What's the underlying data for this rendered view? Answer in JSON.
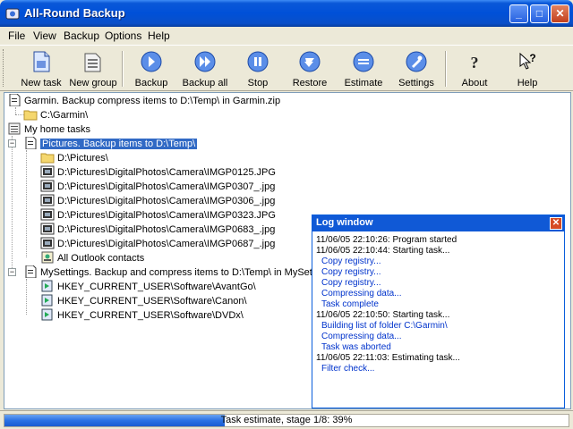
{
  "window": {
    "title": "All-Round Backup",
    "controls": {
      "minimize": "_",
      "maximize": "□",
      "close": "✕"
    }
  },
  "menu": [
    {
      "label": "File"
    },
    {
      "label": "View"
    },
    {
      "label": "Backup"
    },
    {
      "label": "Options"
    },
    {
      "label": "Help"
    }
  ],
  "toolbar": {
    "buttons": [
      {
        "label": "New task",
        "icon": "new-task-icon"
      },
      {
        "label": "New group",
        "icon": "new-group-icon"
      },
      {
        "label": "Backup",
        "icon": "backup-icon"
      },
      {
        "label": "Backup all",
        "icon": "backup-all-icon"
      },
      {
        "label": "Stop",
        "icon": "stop-icon"
      },
      {
        "label": "Restore",
        "icon": "restore-icon"
      },
      {
        "label": "Estimate",
        "icon": "estimate-icon"
      },
      {
        "label": "Settings",
        "icon": "settings-icon"
      },
      {
        "label": "About",
        "icon": "about-icon"
      },
      {
        "label": "Help",
        "icon": "help-icon"
      }
    ]
  },
  "tree": {
    "garmin_task": "Garmin. Backup compress items to D:\\Temp\\ in Garmin.zip",
    "garmin_folder": "C:\\Garmin\\",
    "group": "My home tasks",
    "pictures_task": "Pictures. Backup items to D:\\Temp\\",
    "pictures_items": [
      "D:\\Pictures\\",
      "D:\\Pictures\\DigitalPhotos\\Camera\\IMGP0125.JPG",
      "D:\\Pictures\\DigitalPhotos\\Camera\\IMGP0307_.jpg",
      "D:\\Pictures\\DigitalPhotos\\Camera\\IMGP0306_.jpg",
      "D:\\Pictures\\DigitalPhotos\\Camera\\IMGP0323.JPG",
      "D:\\Pictures\\DigitalPhotos\\Camera\\IMGP0683_.jpg",
      "D:\\Pictures\\DigitalPhotos\\Camera\\IMGP0687_.jpg",
      "All Outlook contacts"
    ],
    "settings_task": "MySettings. Backup and compress items to D:\\Temp\\ in MySettings",
    "settings_items": [
      "HKEY_CURRENT_USER\\Software\\AvantGo\\",
      "HKEY_CURRENT_USER\\Software\\Canon\\",
      "HKEY_CURRENT_USER\\Software\\DVDx\\"
    ]
  },
  "log": {
    "title": "Log window",
    "lines": [
      {
        "text": "11/06/05 22:10:26: Program started",
        "sub": false
      },
      {
        "text": "11/06/05 22:10:44: Starting task...",
        "sub": false
      },
      {
        "text": "Copy registry...",
        "sub": true
      },
      {
        "text": "Copy registry...",
        "sub": true
      },
      {
        "text": "Copy registry...",
        "sub": true
      },
      {
        "text": "Compressing data...",
        "sub": true
      },
      {
        "text": "Task complete",
        "sub": true
      },
      {
        "text": "11/06/05 22:10:50: Starting task...",
        "sub": false
      },
      {
        "text": "Building list of folder C:\\Garmin\\",
        "sub": true
      },
      {
        "text": "Compressing data...",
        "sub": true
      },
      {
        "text": "Task was aborted",
        "sub": true
      },
      {
        "text": "11/06/05 22:11:03: Estimating task...",
        "sub": false
      },
      {
        "text": "Filter check...",
        "sub": true
      }
    ]
  },
  "status": {
    "text": "Task estimate, stage 1/8: 39%",
    "progress": 0.39
  },
  "colors": {
    "titlebar": "#0050d8",
    "selection": "#316ac5",
    "log_sub_text": "#0033cc",
    "progress": "#2b71e4"
  }
}
